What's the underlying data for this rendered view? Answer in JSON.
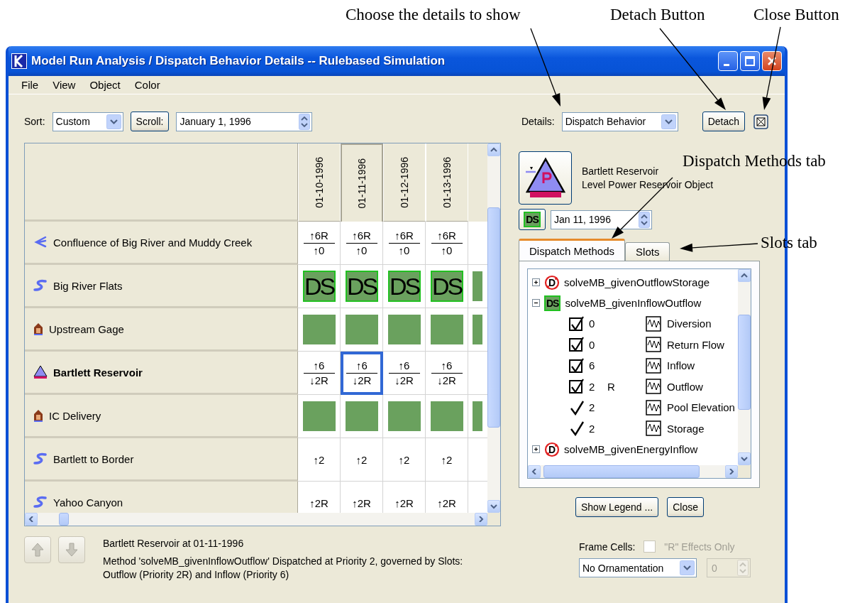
{
  "annotations": [
    {
      "text": "Choose the details to show"
    },
    {
      "text": "Detach Button"
    },
    {
      "text": "Close Button"
    },
    {
      "text": "Dispatch Methods tab"
    },
    {
      "text": "Slots tab"
    }
  ],
  "window": {
    "title": "Model Run Analysis / Dispatch Behavior Details -- Rulebased Simulation"
  },
  "menu": [
    "File",
    "View",
    "Object",
    "Color"
  ],
  "toolbar": {
    "sort_label": "Sort:",
    "sort": "Custom",
    "scroll_button": "Scroll:",
    "date": "January 1, 1996",
    "details_label": "Details:",
    "details": "Dispatch Behavior",
    "detach_button": "Detach"
  },
  "grid": {
    "columns": [
      {
        "label": "01-10-1996",
        "selected": false
      },
      {
        "label": "01-11-1996",
        "selected": true
      },
      {
        "label": "01-12-1996",
        "selected": false
      },
      {
        "label": "01-13-1996",
        "selected": false
      }
    ],
    "rows": [
      {
        "name": "Confluence of Big River and Muddy Creek",
        "kind": "confluence",
        "selected": false,
        "cells": [
          {
            "kind": "fraction",
            "top": "↑6R",
            "bottom": "↑0",
            "selected": false
          },
          {
            "kind": "fraction",
            "top": "↑6R",
            "bottom": "↑0",
            "selected": false
          },
          {
            "kind": "fraction",
            "top": "↑6R",
            "bottom": "↑0",
            "selected": false
          },
          {
            "kind": "fraction",
            "top": "↑6R",
            "bottom": "↑0",
            "selected": false
          }
        ]
      },
      {
        "name": "Big River Flats",
        "kind": "reach",
        "selected": false,
        "cells": [
          {
            "kind": "ds",
            "text": "DS",
            "selected": false
          },
          {
            "kind": "ds",
            "text": "DS",
            "selected": false
          },
          {
            "kind": "ds",
            "text": "DS",
            "selected": false
          },
          {
            "kind": "ds",
            "text": "DS",
            "selected": false
          }
        ]
      },
      {
        "name": "Upstream Gage",
        "kind": "gage",
        "selected": false,
        "cells": [
          {
            "kind": "green",
            "selected": false
          },
          {
            "kind": "green",
            "selected": false
          },
          {
            "kind": "green",
            "selected": false
          },
          {
            "kind": "green",
            "selected": false
          }
        ]
      },
      {
        "name": "Bartlett Reservoir",
        "kind": "reservoir",
        "selected": true,
        "cells": [
          {
            "kind": "fraction",
            "top": "↑6",
            "bottom": "↓2R",
            "selected": false
          },
          {
            "kind": "fraction",
            "top": "↑6",
            "bottom": "↓2R",
            "selected": true
          },
          {
            "kind": "fraction",
            "top": "↑6",
            "bottom": "↓2R",
            "selected": false
          },
          {
            "kind": "fraction",
            "top": "↑6",
            "bottom": "↓2R",
            "selected": false
          }
        ]
      },
      {
        "name": "IC Delivery",
        "kind": "gage",
        "selected": false,
        "cells": [
          {
            "kind": "green",
            "selected": false
          },
          {
            "kind": "green",
            "selected": false
          },
          {
            "kind": "green",
            "selected": false
          },
          {
            "kind": "green",
            "selected": false
          }
        ]
      },
      {
        "name": "Bartlett to Border",
        "kind": "reach",
        "selected": false,
        "cells": [
          {
            "kind": "text",
            "text": "↑2",
            "selected": false
          },
          {
            "kind": "text",
            "text": "↑2",
            "selected": false
          },
          {
            "kind": "text",
            "text": "↑2",
            "selected": false
          },
          {
            "kind": "text",
            "text": "↑2",
            "selected": false
          }
        ]
      },
      {
        "name": "Yahoo Canyon",
        "kind": "reach",
        "selected": false,
        "cells": [
          {
            "kind": "text",
            "text": "↑2R",
            "selected": false
          },
          {
            "kind": "text",
            "text": "↑2R",
            "selected": false
          },
          {
            "kind": "text",
            "text": "↑2R",
            "selected": false
          },
          {
            "kind": "text",
            "text": "↑2R",
            "selected": false
          }
        ]
      }
    ]
  },
  "object": {
    "name": "Bartlett Reservoir",
    "type": "Level Power Reservoir Object",
    "badge": "DS",
    "date": "Jan 11, 1996"
  },
  "tabs": [
    {
      "label": "Dispatch Methods",
      "selected": true
    },
    {
      "label": "Slots",
      "selected": false
    }
  ],
  "tree": [
    {
      "label": "solveMB_givenOutflowStorage",
      "kind": "not_dispatched",
      "badge": "D",
      "expanded": false
    },
    {
      "label": "solveMB_givenInflowOutflow",
      "kind": "dispatched",
      "badge": "DS",
      "expanded": true,
      "children": [
        {
          "kind": "boxed",
          "priority": "0",
          "slot": "Diversion"
        },
        {
          "kind": "boxed",
          "priority": "0",
          "slot": "Return Flow"
        },
        {
          "kind": "boxed",
          "priority": "6",
          "slot": "Inflow"
        },
        {
          "kind": "boxed",
          "priority": "2",
          "flag": "R",
          "slot": "Outflow"
        },
        {
          "kind": "plain",
          "priority": "2",
          "slot": "Pool Elevation"
        },
        {
          "kind": "plain",
          "priority": "2",
          "slot": "Storage"
        }
      ]
    },
    {
      "label": "solveMB_givenEnergyInflow",
      "kind": "not_dispatched",
      "badge": "D",
      "expanded": false
    }
  ],
  "buttons": [
    "Show Legend ...",
    "Close"
  ],
  "status": {
    "nav_buttons": [
      {
        "kind": "up",
        "disabled": true
      },
      {
        "kind": "down",
        "disabled": true
      }
    ],
    "title": "Bartlett Reservoir at 01-11-1996",
    "message": "Method 'solveMB_givenInflowOutflow' Dispatched at Priority 2, governed by Slots: Outflow (Priority 2R) and Inflow (Priority 6)"
  },
  "frame_cells": {
    "label": "Frame Cells:",
    "checkbox": {
      "label": "\"R\" Effects Only",
      "checked": false,
      "disabled": true
    },
    "ornamentation": "No Ornamentation",
    "spinner": {
      "value": "0",
      "disabled": true
    }
  }
}
